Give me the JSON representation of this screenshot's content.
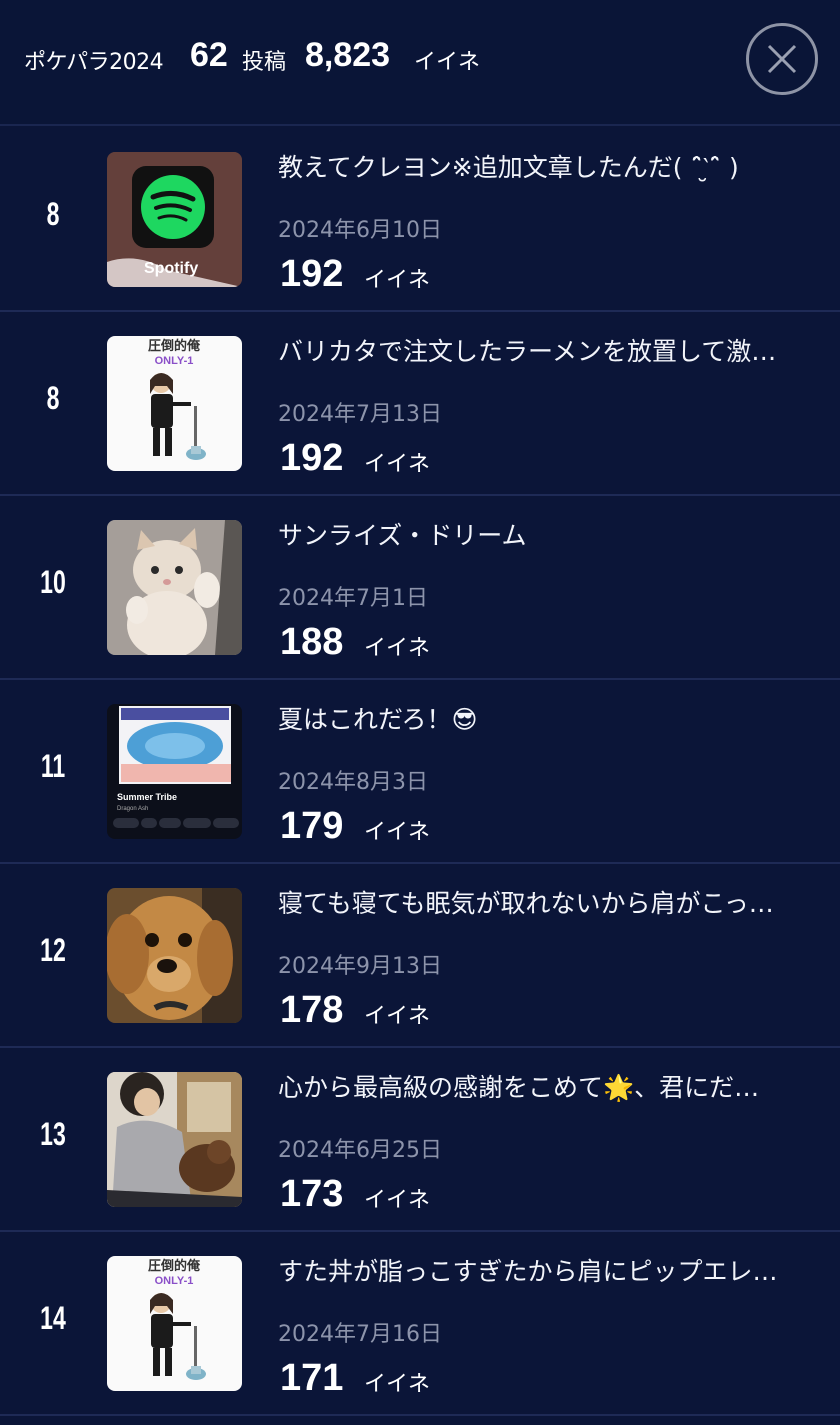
{
  "header": {
    "title": "ポケパラ2024",
    "post_count": "62",
    "post_unit": "投稿",
    "like_count": "8,823",
    "like_unit": "イイネ",
    "close_icon": "close-icon"
  },
  "colors": {
    "background": "#0b1538",
    "divider": "#1e2a56",
    "date_text": "#8d94ab"
  },
  "posts": [
    {
      "rank": "8",
      "title": "教えてクレヨン※追加文章したんだ( ˆ̑‵̮ˆ̑ )",
      "date": "2024年6月10日",
      "likes": "192",
      "likes_unit": "イイネ",
      "thumb": "spotify-logo-thumbnail",
      "thumb_label": "Spotify"
    },
    {
      "rank": "8",
      "title": "バリカタで注文したラーメンを放置して激…",
      "date": "2024年7月13日",
      "likes": "192",
      "likes_unit": "イイネ",
      "thumb": "illustration-thumbnail",
      "thumb_top": "圧倒的俺",
      "thumb_sub": "ONLY-1"
    },
    {
      "rank": "10",
      "title": "サンライズ・ドリーム",
      "date": "2024年7月1日",
      "likes": "188",
      "likes_unit": "イイネ",
      "thumb": "kitten-photo-thumbnail"
    },
    {
      "rank": "11",
      "title": "夏はこれだろ！😎",
      "date": "2024年8月3日",
      "likes": "179",
      "likes_unit": "イイネ",
      "thumb": "music-app-screenshot-thumbnail",
      "thumb_label": "Summer Tribe",
      "thumb_sub": "Dragon Ash"
    },
    {
      "rank": "12",
      "title": "寝ても寝ても眠気が取れないから肩がこっ…",
      "date": "2024年9月13日",
      "likes": "178",
      "likes_unit": "イイネ",
      "thumb": "dog-photo-thumbnail"
    },
    {
      "rank": "13",
      "title": "心から最高級の感謝をこめて🌟、君にだ…",
      "date": "2024年6月25日",
      "likes": "173",
      "likes_unit": "イイネ",
      "thumb": "person-with-dog-photo-thumbnail"
    },
    {
      "rank": "14",
      "title": "すた丼が脂っこすぎたから肩にピップエレ…",
      "date": "2024年7月16日",
      "likes": "171",
      "likes_unit": "イイネ",
      "thumb": "illustration-thumbnail",
      "thumb_top": "圧倒的俺",
      "thumb_sub": "ONLY-1"
    }
  ]
}
